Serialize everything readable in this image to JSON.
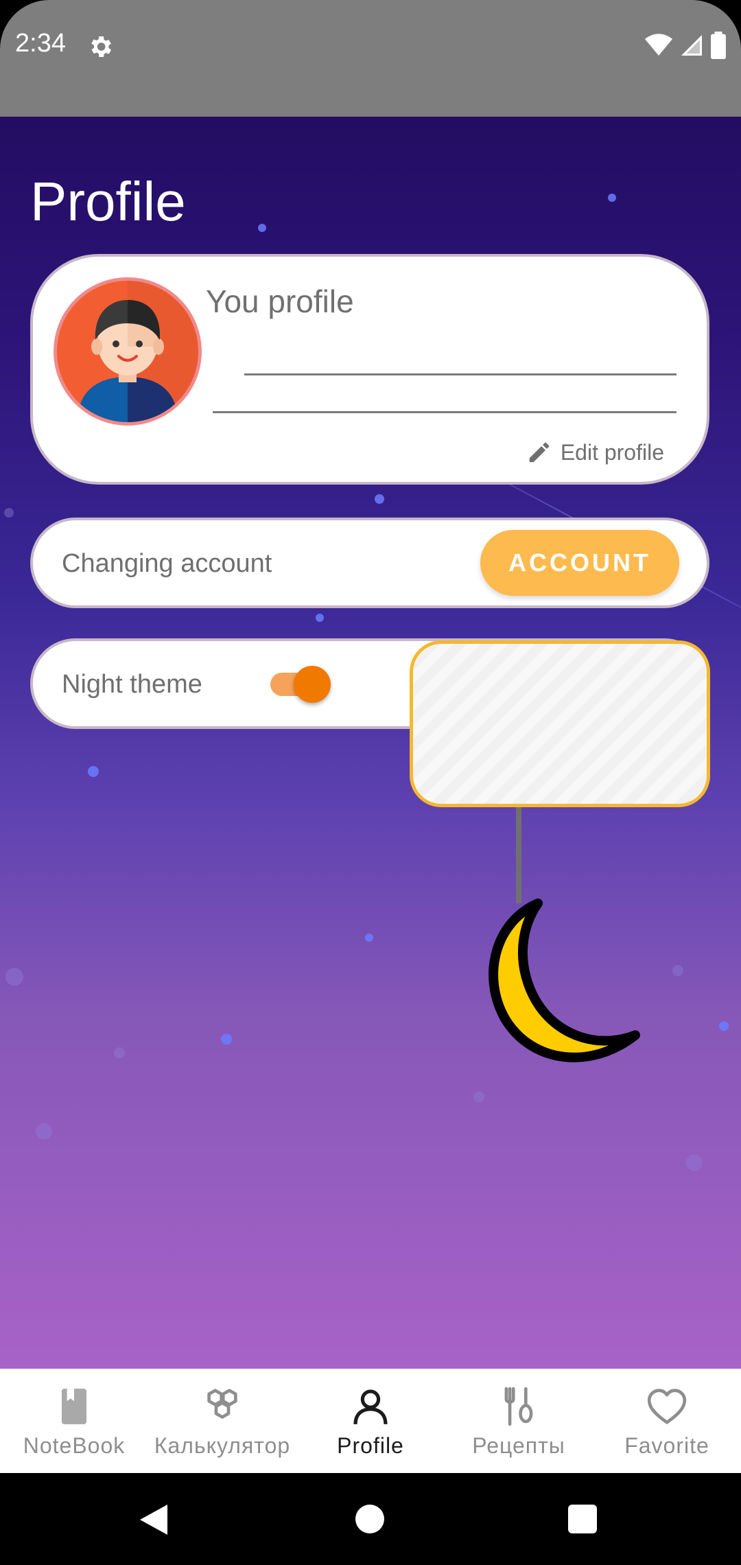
{
  "status_bar": {
    "time": "2:34",
    "icons": [
      "gear-icon",
      "wifi-icon",
      "signal-icon",
      "battery-icon"
    ]
  },
  "page": {
    "title": "Profile"
  },
  "profile_card": {
    "heading": "You profile",
    "edit_label": "Edit profile",
    "edit_icon": "pencil-icon",
    "avatar": "avatar-boy"
  },
  "account_card": {
    "label": "Changing account",
    "button_label": "ACCOUNT"
  },
  "night_card": {
    "label": "Night theme",
    "toggle_on": true
  },
  "bottom_nav": {
    "items": [
      {
        "label": "NoteBook",
        "icon": "book-icon",
        "active": false
      },
      {
        "label": "Калькулятор",
        "icon": "hexagons-icon",
        "active": false
      },
      {
        "label": "Profile",
        "icon": "person-icon",
        "active": true
      },
      {
        "label": "Рецепты",
        "icon": "fork-spoon-icon",
        "active": false
      },
      {
        "label": "Favorite",
        "icon": "heart-icon",
        "active": false
      }
    ]
  },
  "colors": {
    "accent": "#fdba4e",
    "toggle": "#f07a00",
    "background_top": "#220d63",
    "background_bottom": "#a862c8"
  }
}
